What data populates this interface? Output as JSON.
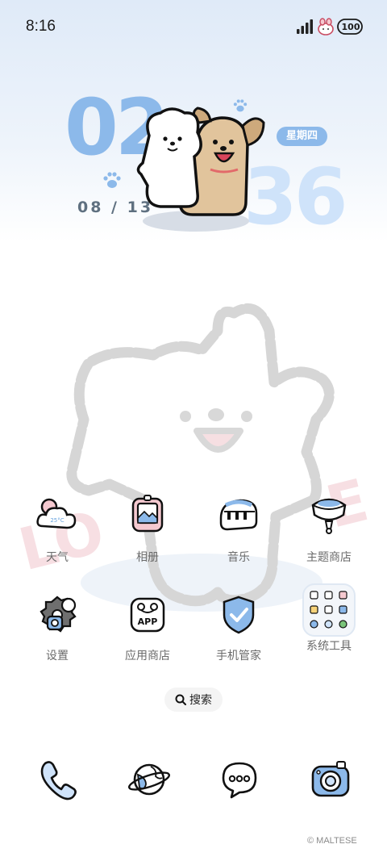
{
  "status_bar": {
    "time": "8:16",
    "battery": "100",
    "icons": [
      "signal-icon",
      "bunny-icon",
      "battery-icon"
    ]
  },
  "clock": {
    "hour": "02",
    "minute": "36",
    "date": "08 / 13",
    "weekday": "星期四"
  },
  "wallpaper": {
    "love_left": "LO",
    "love_right": "E"
  },
  "apps": [
    {
      "label": "天气",
      "icon": "weather-icon",
      "temp": "25°C"
    },
    {
      "label": "相册",
      "icon": "gallery-icon"
    },
    {
      "label": "音乐",
      "icon": "music-icon"
    },
    {
      "label": "主题商店",
      "icon": "theme-store-icon"
    },
    {
      "label": "设置",
      "icon": "settings-icon"
    },
    {
      "label": "应用商店",
      "icon": "app-store-icon",
      "badge": "APP"
    },
    {
      "label": "手机管家",
      "icon": "phone-manager-icon"
    },
    {
      "label": "系统工具",
      "icon": "system-tools-folder-icon"
    }
  ],
  "search": {
    "label": "搜索",
    "icon": "search-icon"
  },
  "dock": [
    {
      "icon": "phone-icon"
    },
    {
      "icon": "browser-icon"
    },
    {
      "icon": "messages-icon"
    },
    {
      "icon": "camera-icon"
    }
  ],
  "footer": {
    "copyright": "© MALTESE"
  },
  "colors": {
    "accent_blue": "#8cb9ea",
    "light_blue": "#cfe3fa",
    "pink": "#f5c9d0",
    "label_gray": "#6b6b6b"
  }
}
